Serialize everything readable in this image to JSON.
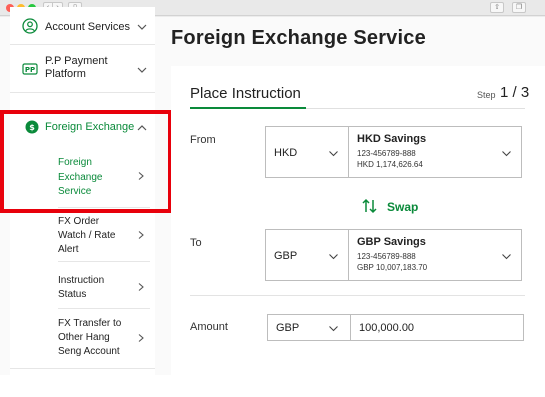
{
  "sidebar": {
    "items": [
      {
        "label": "Account Services",
        "icon": "user-circle-icon"
      },
      {
        "label_line1": "P.P Payment",
        "label_line2": "Platform",
        "icon": "payment-icon"
      },
      {
        "label": "Foreign Exchange",
        "icon": "exchange-icon",
        "expanded": true
      }
    ],
    "subitems": [
      {
        "line1": "Foreign",
        "line2": "Exchange",
        "line3": "Service",
        "active": true
      },
      {
        "line1": "FX Order",
        "line2": "Watch / Rate",
        "line3": "Alert"
      },
      {
        "line1": "Instruction",
        "line2": "Status"
      },
      {
        "line1": "FX Transfer to",
        "line2": "Other Hang",
        "line3": "Seng Account"
      }
    ]
  },
  "main": {
    "title": "Foreign Exchange Service",
    "card_title": "Place Instruction",
    "step_label": "Step",
    "step_value": "1 / 3",
    "from": {
      "label": "From",
      "currency": "HKD",
      "account_name": "HKD Savings",
      "account_number": "123-456789-888",
      "balance": "HKD 1,174,626.64"
    },
    "swap_label": "Swap",
    "to": {
      "label": "To",
      "currency": "GBP",
      "account_name": "GBP Savings",
      "account_number": "123-456789-888",
      "balance": "GBP 10,007,183.70"
    },
    "amount": {
      "label": "Amount",
      "currency": "GBP",
      "value": "100,000.00"
    }
  },
  "colors": {
    "accent_green": "#0a8a3a",
    "highlight_red": "#e8000b"
  }
}
